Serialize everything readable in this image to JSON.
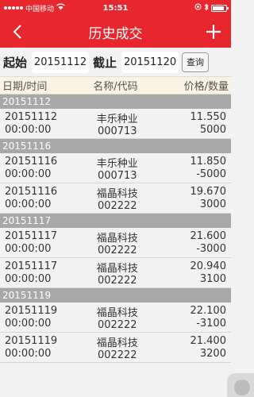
{
  "status_bar": {
    "carrier": "中国移动",
    "time": "15:51"
  },
  "nav": {
    "title": "历史成交"
  },
  "search": {
    "start_label": "起始",
    "start_value": "20151112",
    "end_label": "截止",
    "end_value": "20151120",
    "query_label": "查询"
  },
  "table_header": {
    "date_time": "日期/时间",
    "name_code": "名称/代码",
    "price_qty": "价格/数量"
  },
  "groups": [
    {
      "date": "20151112",
      "records": [
        {
          "date": "20151112",
          "time": "00:00:00",
          "name": "丰乐种业",
          "code": "000713",
          "price": "11.550",
          "qty": "5000"
        }
      ]
    },
    {
      "date": "20151116",
      "records": [
        {
          "date": "20151116",
          "time": "00:00:00",
          "name": "丰乐种业",
          "code": "000713",
          "price": "11.850",
          "qty": "-5000"
        },
        {
          "date": "20151116",
          "time": "00:00:00",
          "name": "福晶科技",
          "code": "002222",
          "price": "19.670",
          "qty": "3000"
        }
      ]
    },
    {
      "date": "20151117",
      "records": [
        {
          "date": "20151117",
          "time": "00:00:00",
          "name": "福晶科技",
          "code": "002222",
          "price": "21.600",
          "qty": "-3000"
        },
        {
          "date": "20151117",
          "time": "00:00:00",
          "name": "福晶科技",
          "code": "002222",
          "price": "20.940",
          "qty": "3100"
        }
      ]
    },
    {
      "date": "20151119",
      "records": [
        {
          "date": "20151119",
          "time": "00:00:00",
          "name": "福晶科技",
          "code": "002222",
          "price": "22.100",
          "qty": "-3100"
        },
        {
          "date": "20151119",
          "time": "00:00:00",
          "name": "福晶科技",
          "code": "002222",
          "price": "21.400",
          "qty": "3200"
        }
      ]
    }
  ]
}
